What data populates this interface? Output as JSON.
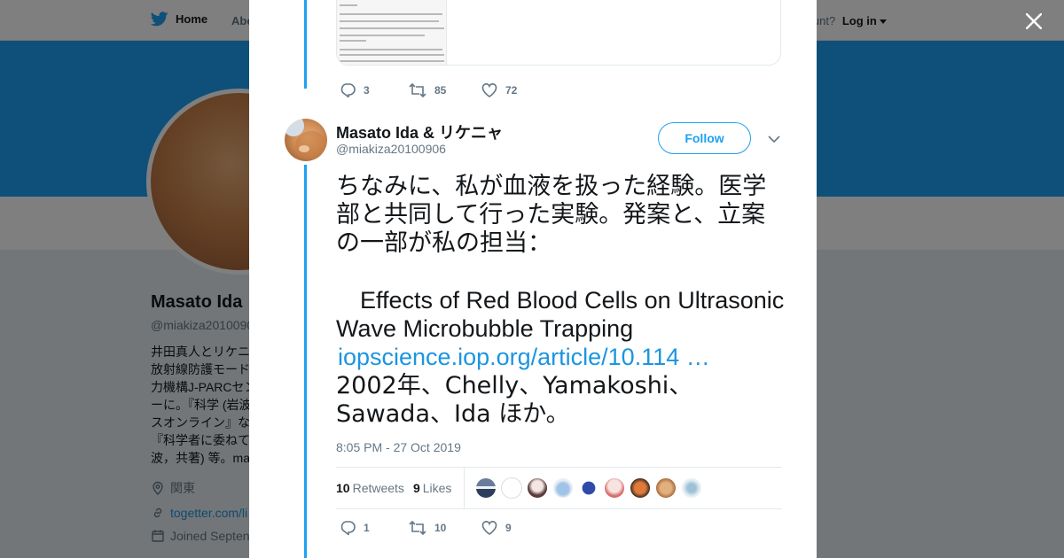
{
  "nav": {
    "home": "Home",
    "about": "Abo",
    "account_prompt": "Account?",
    "login": "Log in"
  },
  "profile": {
    "name": "Masato Ida",
    "handle": "@miakiza2010090",
    "bio_lines": [
      "井田真人とリケニ",
      "放射線防護モード",
      "力機構J-PARCセン",
      "ーに。『科学 (岩波",
      "スオンライン』な",
      "『科学者に委ねて",
      "波，共著) 等。ma"
    ],
    "location": "関東",
    "link": "togetter.com/li",
    "joined": "Joined Septen"
  },
  "previous_tweet": {
    "reply_count": "3",
    "retweet_count": "85",
    "like_count": "72"
  },
  "tweet": {
    "display_name": "Masato Ida & リケニャ",
    "handle": "@miakiza20100906",
    "follow_label": "Follow",
    "text_ja": "ちなみに、私が血液を扱った経験。医学部と共同して行った実験。発案と、立案の一部が私の担当：",
    "text_en": "Effects of Red Blood Cells on Ultrasonic Wave Microbubble Trapping",
    "link": "iopscience.iop.org/article/10.114 …",
    "authors": "2002年、Chelly、Yamakoshi、Sawada、Ida ほか。",
    "timestamp": "8:05 PM - 27 Oct 2019",
    "retweets_count": "10",
    "retweets_label": "Retweets",
    "likes_count": "9",
    "likes_label": "Likes",
    "reply_count": "1",
    "retweet_count": "10",
    "like_count": "9"
  },
  "icons": {
    "bird": "twitter-bird-icon",
    "close": "close-icon",
    "reply": "reply-icon",
    "retweet": "retweet-icon",
    "like": "heart-icon",
    "menu": "chevron-down-icon",
    "location": "location-pin-icon",
    "link": "link-icon",
    "calendar": "calendar-icon"
  },
  "colors": {
    "accent": "#1da1f2",
    "link": "#1b95e0",
    "muted": "#657786",
    "text": "#14171a"
  }
}
